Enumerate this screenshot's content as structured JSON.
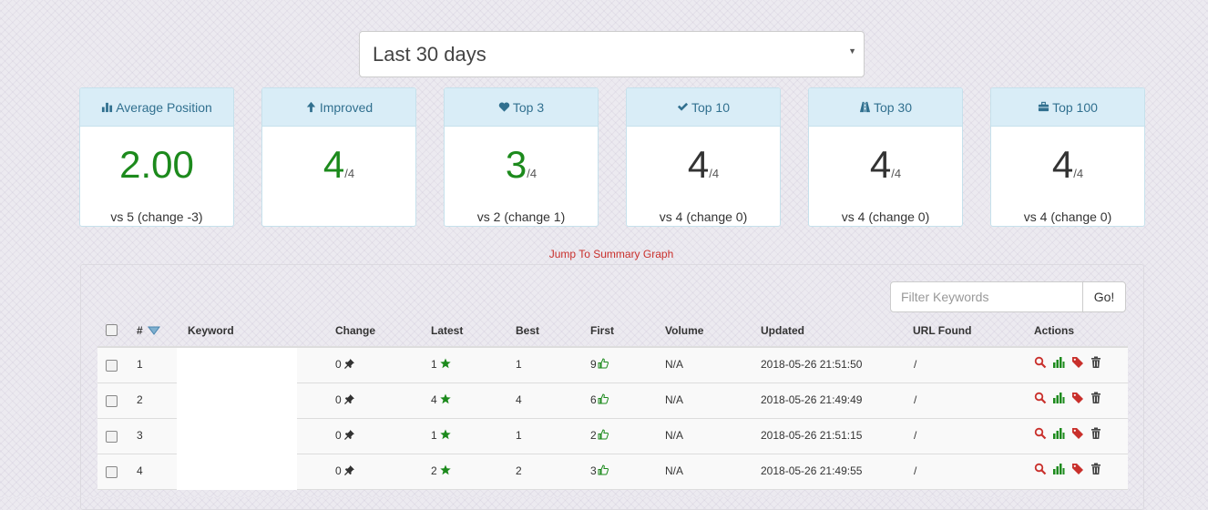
{
  "date_range": {
    "selected": "Last 30 days"
  },
  "cards": [
    {
      "title": "Average Position",
      "icon": "bar-chart-icon",
      "value": "2.00",
      "denominator": "",
      "footer": "vs 5 (change -3)",
      "color": "#1c8a1c"
    },
    {
      "title": "Improved",
      "icon": "arrow-up-icon",
      "value": "4",
      "denominator": "/4",
      "footer": "",
      "color": "#1c8a1c"
    },
    {
      "title": "Top 3",
      "icon": "heart-icon",
      "value": "3",
      "denominator": "/4",
      "footer": "vs 2 (change 1)",
      "color": "#1c8a1c"
    },
    {
      "title": "Top 10",
      "icon": "checkmark-icon",
      "value": "4",
      "denominator": "/4",
      "footer": "vs 4 (change 0)",
      "color": "#333333"
    },
    {
      "title": "Top 30",
      "icon": "road-icon",
      "value": "4",
      "denominator": "/4",
      "footer": "vs 4 (change 0)",
      "color": "#333333"
    },
    {
      "title": "Top 100",
      "icon": "briefcase-icon",
      "value": "4",
      "denominator": "/4",
      "footer": "vs 4 (change 0)",
      "color": "#333333"
    }
  ],
  "jump_link": "Jump To Summary Graph",
  "filter": {
    "placeholder": "Filter Keywords",
    "button": "Go!"
  },
  "table": {
    "headers": [
      "#",
      "Keyword",
      "Change",
      "Latest",
      "Best",
      "First",
      "Volume",
      "Updated",
      "URL Found",
      "Actions"
    ],
    "rows": [
      {
        "num": "1",
        "change": "0",
        "latest": "1",
        "best": "1",
        "first": "9",
        "volume": "N/A",
        "updated": "2018-05-26 21:51:50",
        "url": "/"
      },
      {
        "num": "2",
        "change": "0",
        "latest": "4",
        "best": "4",
        "first": "6",
        "volume": "N/A",
        "updated": "2018-05-26 21:49:49",
        "url": "/"
      },
      {
        "num": "3",
        "change": "0",
        "latest": "1",
        "best": "1",
        "first": "2",
        "volume": "N/A",
        "updated": "2018-05-26 21:51:15",
        "url": "/"
      },
      {
        "num": "4",
        "change": "0",
        "latest": "2",
        "best": "2",
        "first": "3",
        "volume": "N/A",
        "updated": "2018-05-26 21:49:55",
        "url": "/"
      }
    ]
  },
  "icons": {
    "pin": "pushpin-icon",
    "star": "star-icon",
    "thumb": "thumbs-up-icon",
    "actions": [
      "search-icon",
      "stats-icon",
      "tags-icon",
      "trash-icon"
    ],
    "sort": "sort-arrow-icon"
  },
  "colors": {
    "green": "#1c8a1c",
    "accent_red": "#c9302c",
    "header_blue": "#d9edf7"
  }
}
